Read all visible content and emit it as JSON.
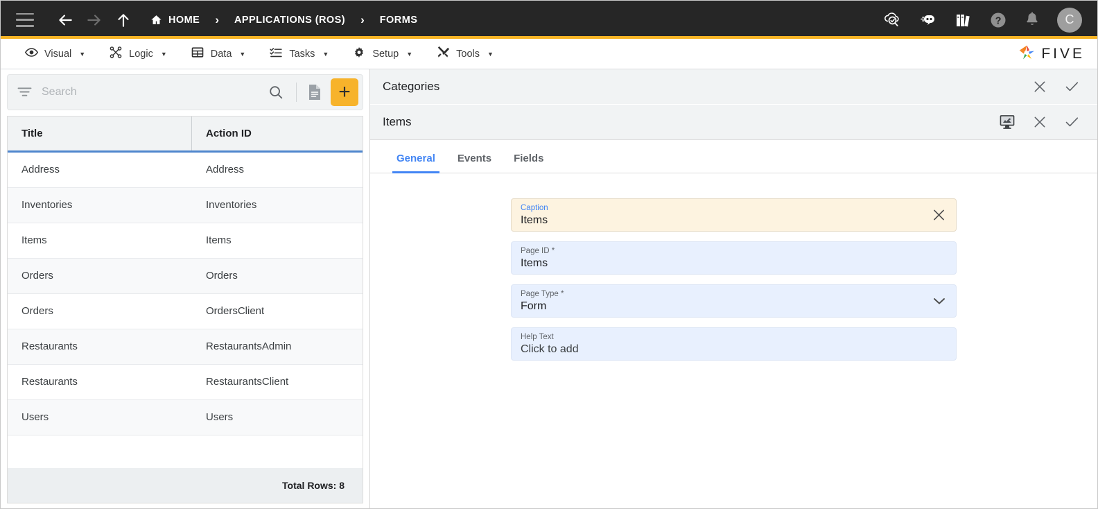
{
  "topbar": {
    "menu_icon": "hamburger-icon",
    "back_icon": "arrow-left-icon",
    "forward_icon": "arrow-right-icon",
    "up_icon": "arrow-up-icon",
    "breadcrumbs": [
      {
        "label": "HOME",
        "icon": "home-icon"
      },
      {
        "label": "APPLICATIONS (ROS)",
        "icon": ""
      },
      {
        "label": "FORMS",
        "icon": ""
      }
    ],
    "separator": "›",
    "right_icons": [
      {
        "name": "cloud-search-icon"
      },
      {
        "name": "chat-bot-icon"
      },
      {
        "name": "library-books-icon"
      },
      {
        "name": "help-icon"
      },
      {
        "name": "notifications-bell-icon"
      }
    ],
    "avatar_initial": "C",
    "accent_color": "#f6b425",
    "background_color": "#262626"
  },
  "menubar": {
    "items": [
      {
        "label": "Visual",
        "icon": "eye-icon"
      },
      {
        "label": "Logic",
        "icon": "logic-nodes-icon"
      },
      {
        "label": "Data",
        "icon": "table-grid-icon"
      },
      {
        "label": "Tasks",
        "icon": "task-list-icon"
      },
      {
        "label": "Setup",
        "icon": "gear-icon"
      },
      {
        "label": "Tools",
        "icon": "tools-icon"
      }
    ],
    "caret": "▼",
    "brand": "FIVE"
  },
  "left_panel": {
    "search": {
      "placeholder": "Search",
      "value": "",
      "filter_icon": "filter-icon",
      "search_icon": "search-icon",
      "document_icon": "document-icon",
      "add_label": "+"
    },
    "table": {
      "columns": [
        "Title",
        "Action ID"
      ],
      "rows": [
        {
          "title": "Address",
          "action_id": "Address"
        },
        {
          "title": "Inventories",
          "action_id": "Inventories"
        },
        {
          "title": "Items",
          "action_id": "Items"
        },
        {
          "title": "Orders",
          "action_id": "Orders"
        },
        {
          "title": "Orders",
          "action_id": "OrdersClient"
        },
        {
          "title": "Restaurants",
          "action_id": "RestaurantsAdmin"
        },
        {
          "title": "Restaurants",
          "action_id": "RestaurantsClient"
        },
        {
          "title": "Users",
          "action_id": "Users"
        }
      ],
      "footer": "Total Rows: 8"
    }
  },
  "right_panel": {
    "header_bars": [
      {
        "title": "Categories",
        "actions": [
          "close-icon",
          "confirm-icon"
        ]
      },
      {
        "title": "Items",
        "actions": [
          "screen-preview-icon",
          "close-icon",
          "confirm-icon"
        ]
      }
    ],
    "tabs": [
      {
        "label": "General",
        "active": true
      },
      {
        "label": "Events",
        "active": false
      },
      {
        "label": "Fields",
        "active": false
      }
    ],
    "active_tab_color": "#4285f4",
    "fields": [
      {
        "label": "Caption",
        "value": "Items",
        "style": "caption",
        "action_icon": "clear-x-icon"
      },
      {
        "label": "Page ID *",
        "value": "Items",
        "style": "blue",
        "action_icon": ""
      },
      {
        "label": "Page Type *",
        "value": "Form",
        "style": "blue",
        "action_icon": "chevron-down-icon"
      },
      {
        "label": "Help Text",
        "value": "Click to add",
        "style": "blue",
        "action_icon": ""
      }
    ]
  }
}
